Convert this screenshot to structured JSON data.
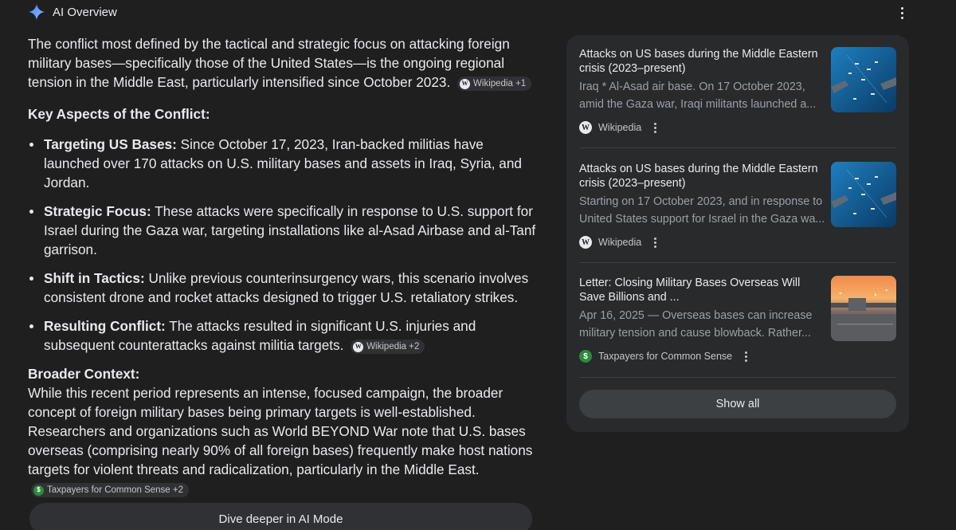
{
  "header": {
    "title": "AI Overview",
    "icon": "gemini-sparkle-icon",
    "menu_icon": "more-vert-icon"
  },
  "main": {
    "intro_text": "The conflict most defined by the tactical and strategic focus on attacking foreign military bases—specifically those of the United States—is the ongoing regional tension in the Middle East, particularly intensified since October 2023.",
    "intro_chip": "Wikipedia +1",
    "key_heading": "Key Aspects of the Conflict:",
    "aspects": [
      {
        "label": "Targeting US Bases:",
        "text": "Since October 17, 2023, Iran-backed militias have launched over 170 attacks on U.S. military bases and assets in Iraq, Syria, and Jordan."
      },
      {
        "label": "Strategic Focus:",
        "text": "These attacks were specifically in response to U.S. support for Israel during the Gaza war, targeting installations like al-Asad Airbase and al-Tanf garrison."
      },
      {
        "label": "Shift in Tactics:",
        "text": "Unlike previous counterinsurgency wars, this scenario involves consistent drone and rocket attacks designed to trigger U.S. retaliatory strikes."
      },
      {
        "label": "Resulting Conflict:",
        "text": "The attacks resulted in significant U.S. injuries and subsequent counterattacks against militia targets.",
        "chip": "Wikipedia +2"
      }
    ],
    "broader_heading": "Broader Context:",
    "broader_text": "While this recent period represents an intense, focused campaign, the broader concept of foreign military bases being primary targets is well-established. Researchers and organizations such as World BEYOND War note that U.S. bases overseas (comprising nearly 90% of all foreign bases) frequently make host nations targets for violent threats and radicalization, particularly in the Middle East.",
    "broader_chip": "Taxpayers for Common Sense +2",
    "dive_button": "Dive deeper in AI Mode"
  },
  "sources": [
    {
      "title": "Attacks on US bases during the Middle Eastern crisis (2023–present)",
      "snippet_line1": "Iraq * Al-Asad air base. On 17 October 2023,",
      "snippet_line2": "amid the Gaza war, Iraqi militants launched a...",
      "source": "Wikipedia",
      "source_icon": "W",
      "thumbnail": "naval-fleet-image"
    },
    {
      "title": "Attacks on US bases during the Middle Eastern crisis (2023–present)",
      "snippet_line1": "Starting on 17 October 2023, and in response to",
      "snippet_line2": "United States support for Israel in the Gaza wa...",
      "source": "Wikipedia",
      "source_icon": "W",
      "thumbnail": "naval-fleet-image"
    },
    {
      "title": "Letter: Closing Military Bases Overseas Will Save Billions and ...",
      "snippet_line1": "Apr 16, 2025 — Overseas bases can increase",
      "snippet_line2": "military tension and cause blowback. Rather...",
      "source": "Taxpayers for Common Sense",
      "source_icon": "$",
      "thumbnail": "military-base-sunset-image"
    }
  ],
  "show_all_label": "Show all",
  "colors": {
    "background": "#1f1f1f",
    "panel": "#282a2c",
    "text": "#e8eaed",
    "muted": "#9aa0a6",
    "chip": "#303134",
    "taxpayers_green": "#2e8b3e"
  }
}
